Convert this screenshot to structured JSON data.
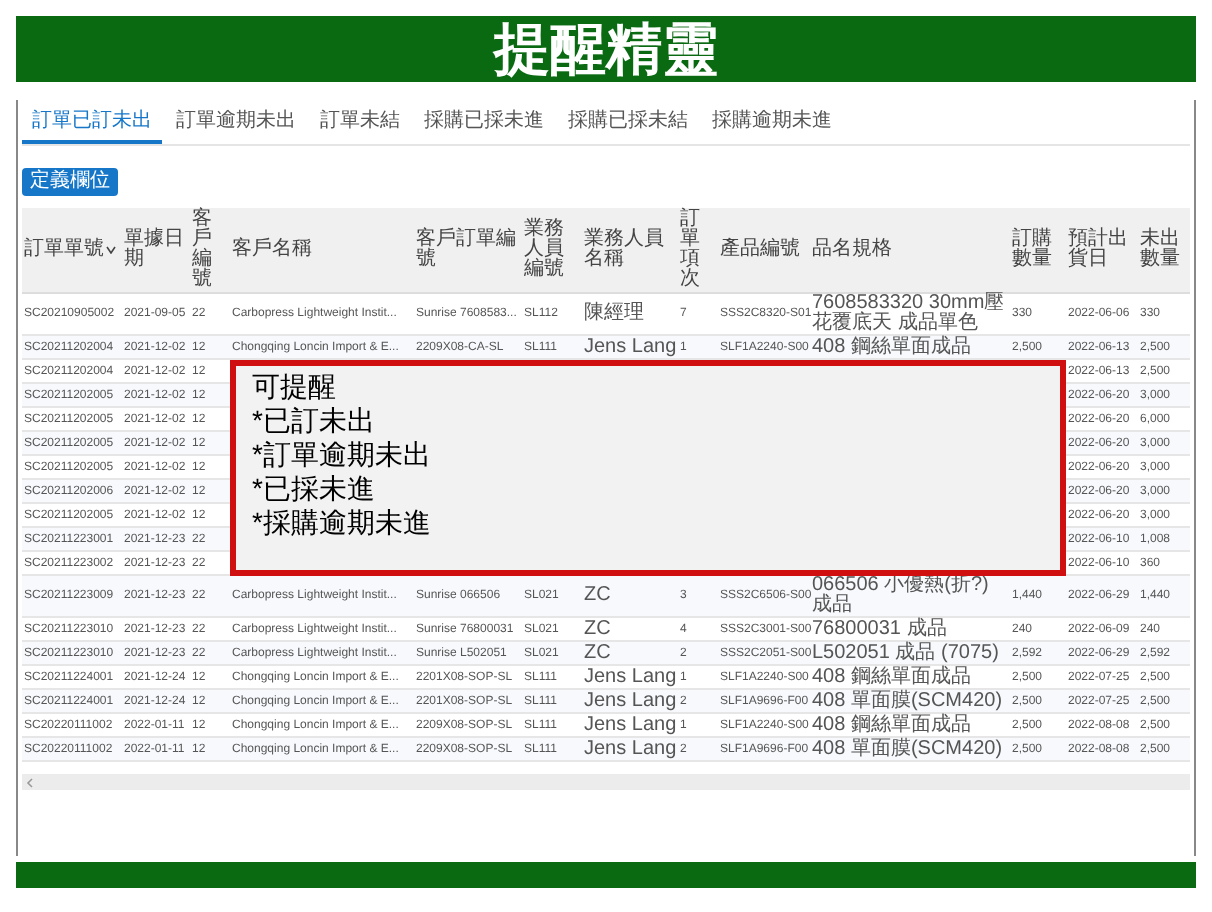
{
  "slide": {
    "title": "提醒精靈"
  },
  "tabs": [
    {
      "label": "訂單已訂未出",
      "selected": true
    },
    {
      "label": "訂單逾期未出",
      "selected": false
    },
    {
      "label": "訂單未結",
      "selected": false
    },
    {
      "label": "採購已採未進",
      "selected": false
    },
    {
      "label": "採購已採未結",
      "selected": false
    },
    {
      "label": "採購逾期未進",
      "selected": false
    }
  ],
  "button": {
    "label": "定義欄位"
  },
  "table": {
    "columns": [
      {
        "label": "訂單單號",
        "sorted": true
      },
      {
        "label": "單據日期",
        "sorted": false
      },
      {
        "label": "客戶編號",
        "sorted": false
      },
      {
        "label": "客戶名稱",
        "sorted": false
      },
      {
        "label": "客戶訂單編號",
        "sorted": false
      },
      {
        "label": "業務人員編號",
        "sorted": false
      },
      {
        "label": "業務人員名稱",
        "sorted": false
      },
      {
        "label": "訂單項次",
        "sorted": false
      },
      {
        "label": "產品編號",
        "sorted": false
      },
      {
        "label": "品名規格",
        "sorted": false
      },
      {
        "label": "訂購數量",
        "sorted": false
      },
      {
        "label": "預計出貨日",
        "sorted": false
      },
      {
        "label": "未出數量",
        "sorted": false
      }
    ],
    "rows": [
      {
        "cells": [
          "SC20210905002",
          "2021-09-05",
          "22",
          "Carbopress Lightweight Instit...",
          "Sunrise 7608583...",
          "SL112",
          "陳經理",
          "7",
          "SSS2C8320-S01",
          "7608583320 30mm壓花覆底天 成品單色",
          "330",
          "2022-06-06",
          "330"
        ]
      },
      {
        "cells": [
          "SC20211202004",
          "2021-12-02",
          "12",
          "Chongqing Loncin Import & E...",
          "2209X08-CA-SL",
          "SL111",
          "Jens Lang",
          "1",
          "SLF1A2240-S00",
          "408 鋼絲單面成品",
          "2,500",
          "2022-06-13",
          "2,500"
        ]
      },
      {
        "cells": [
          "SC20211202004",
          "2021-12-02",
          "12",
          null,
          null,
          null,
          null,
          null,
          null,
          null,
          null,
          "2022-06-13",
          "2,500"
        ]
      },
      {
        "cells": [
          "SC20211202005",
          "2021-12-02",
          "12",
          null,
          null,
          null,
          null,
          null,
          null,
          null,
          null,
          "2022-06-20",
          "3,000"
        ]
      },
      {
        "cells": [
          "SC20211202005",
          "2021-12-02",
          "12",
          null,
          null,
          null,
          null,
          null,
          null,
          null,
          null,
          "2022-06-20",
          "6,000"
        ]
      },
      {
        "cells": [
          "SC20211202005",
          "2021-12-02",
          "12",
          null,
          null,
          null,
          null,
          null,
          null,
          null,
          null,
          "2022-06-20",
          "3,000"
        ]
      },
      {
        "cells": [
          "SC20211202005",
          "2021-12-02",
          "12",
          null,
          null,
          null,
          null,
          null,
          null,
          null,
          null,
          "2022-06-20",
          "3,000"
        ]
      },
      {
        "cells": [
          "SC20211202006",
          "2021-12-02",
          "12",
          null,
          null,
          null,
          null,
          null,
          null,
          null,
          null,
          "2022-06-20",
          "3,000"
        ]
      },
      {
        "cells": [
          "SC20211202005",
          "2021-12-02",
          "12",
          null,
          null,
          null,
          null,
          null,
          null,
          null,
          null,
          "2022-06-20",
          "3,000"
        ]
      },
      {
        "cells": [
          "SC20211223001",
          "2021-12-23",
          "22",
          null,
          null,
          null,
          null,
          null,
          null,
          null,
          null,
          "2022-06-10",
          "1,008"
        ]
      },
      {
        "cells": [
          "SC20211223002",
          "2021-12-23",
          "22",
          null,
          null,
          null,
          null,
          null,
          null,
          null,
          null,
          "2022-06-10",
          "360"
        ]
      },
      {
        "cells": [
          "SC20211223009",
          "2021-12-23",
          "22",
          "Carbopress Lightweight Instit...",
          "Sunrise 066506",
          "SL021",
          "ZC",
          "3",
          "SSS2C6506-S00",
          "066506 小優熱(折?) 成品",
          "1,440",
          "2022-06-29",
          "1,440"
        ]
      },
      {
        "cells": [
          "SC20211223010",
          "2021-12-23",
          "22",
          "Carbopress Lightweight Instit...",
          "Sunrise 76800031",
          "SL021",
          "ZC",
          "4",
          "SSS2C3001-S00",
          "76800031 成品",
          "240",
          "2022-06-09",
          "240"
        ]
      },
      {
        "cells": [
          "SC20211223010",
          "2021-12-23",
          "22",
          "Carbopress Lightweight Instit...",
          "Sunrise L502051",
          "SL021",
          "ZC",
          "2",
          "SSS2C2051-S00",
          "L502051 成品 (7075)",
          "2,592",
          "2022-06-29",
          "2,592"
        ]
      },
      {
        "cells": [
          "SC20211224001",
          "2021-12-24",
          "12",
          "Chongqing Loncin Import & E...",
          "2201X08-SOP-SL",
          "SL111",
          "Jens Lang",
          "1",
          "SLF1A2240-S00",
          "408 鋼絲單面成品",
          "2,500",
          "2022-07-25",
          "2,500"
        ]
      },
      {
        "cells": [
          "SC20211224001",
          "2021-12-24",
          "12",
          "Chongqing Loncin Import & E...",
          "2201X08-SOP-SL",
          "SL111",
          "Jens Lang",
          "2",
          "SLF1A9696-F00",
          "408 單面膜(SCM420)",
          "2,500",
          "2022-07-25",
          "2,500"
        ]
      },
      {
        "cells": [
          "SC20220111002",
          "2022-01-11",
          "12",
          "Chongqing Loncin Import & E...",
          "2209X08-SOP-SL",
          "SL111",
          "Jens Lang",
          "1",
          "SLF1A2240-S00",
          "408 鋼絲單面成品",
          "2,500",
          "2022-08-08",
          "2,500"
        ]
      },
      {
        "cells": [
          "SC20220111002",
          "2022-01-11",
          "12",
          "Chongqing Loncin Import & E...",
          "2209X08-SOP-SL",
          "SL111",
          "Jens Lang",
          "2",
          "SLF1A9696-F00",
          "408 單面膜(SCM420)",
          "2,500",
          "2022-08-08",
          "2,500"
        ]
      }
    ]
  },
  "callout": {
    "lines": [
      "可提醒",
      "*已訂未出",
      "*訂單逾期未出",
      "*已採未進",
      "*採購逾期未進"
    ]
  }
}
